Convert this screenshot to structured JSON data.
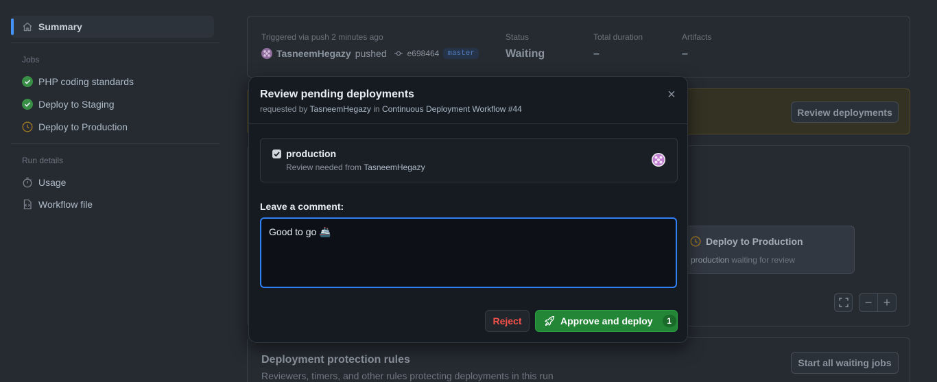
{
  "sidebar": {
    "summary_label": "Summary",
    "jobs_heading": "Jobs",
    "jobs": [
      {
        "label": "PHP coding standards",
        "status": "success"
      },
      {
        "label": "Deploy to Staging",
        "status": "success"
      },
      {
        "label": "Deploy to Production",
        "status": "waiting"
      }
    ],
    "run_details_heading": "Run details",
    "run_details": [
      {
        "label": "Usage",
        "icon": "stopwatch-icon"
      },
      {
        "label": "Workflow file",
        "icon": "file-code-icon"
      }
    ]
  },
  "run_info": {
    "trigger_label": "Triggered via push 2 minutes ago",
    "actor": "TasneemHegazy",
    "action": "pushed",
    "commit_sha": "e698464",
    "branch": "master",
    "status_label": "Status",
    "status_value": "Waiting",
    "duration_label": "Total duration",
    "duration_value": "–",
    "artifacts_label": "Artifacts",
    "artifacts_value": "–"
  },
  "review_banner": {
    "button_label": "Review deployments"
  },
  "graph": {
    "job_title": "Deploy to Production",
    "env_name": "production",
    "env_suffix": "waiting for review",
    "zoom_out_label": "−",
    "zoom_in_label": "+"
  },
  "protection": {
    "title": "Deployment protection rules",
    "subtitle": "Reviewers, timers, and other rules protecting deployments in this run",
    "button_label": "Start all waiting jobs"
  },
  "modal": {
    "title": "Review pending deployments",
    "requested_prefix": "requested by",
    "requester": "TasneemHegazy",
    "in_word": "in",
    "workflow": "Continuous Deployment Workflow #44",
    "close_label": "×",
    "environment": {
      "name": "production",
      "checked": true,
      "review_prefix": "Review needed from",
      "reviewer": "TasneemHegazy"
    },
    "comment_label": "Leave a comment:",
    "comment_value": "Good to go 🚢",
    "reject_label": "Reject",
    "approve_label": "Approve and deploy",
    "approve_count": "1"
  },
  "colors": {
    "accent_blue": "#4493f8",
    "success_green": "#3fb950",
    "waiting_amber": "#d29922",
    "danger_red": "#f85149",
    "primary_button": "#238636"
  }
}
